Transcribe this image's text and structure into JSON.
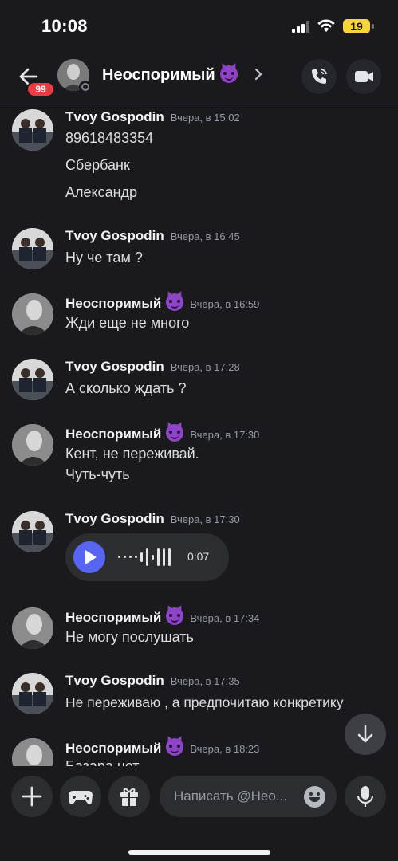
{
  "status_bar": {
    "time": "10:08",
    "battery": "19"
  },
  "header": {
    "unread_badge": "99",
    "contact_name": "Неоспоримый",
    "icons": [
      "back-arrow-icon",
      "chevron-right-icon",
      "phone-call-icon",
      "video-camera-icon"
    ]
  },
  "messages": [
    {
      "author": "Tvoy Gospodin",
      "time": "Вчера, в 15:02",
      "lines": [
        "89618483354",
        "Сбербанк",
        "Александр"
      ]
    },
    {
      "author": "Tvoy Gospodin",
      "time": "Вчера, в 16:45",
      "lines": [
        "Ну че там ?"
      ]
    },
    {
      "author": "Неоспоримый",
      "time": "Вчера, в 16:59",
      "lines": [
        "Жди еще не много"
      ]
    },
    {
      "author": "Tvoy Gospodin",
      "time": "Вчера, в 17:28",
      "lines": [
        "А сколько ждать ?"
      ]
    },
    {
      "author": "Неоспоримый",
      "time": "Вчера, в 17:30",
      "lines": [
        "Кент, не переживай.",
        "Чуть-чуть"
      ]
    },
    {
      "author": "Tvoy Gospodin",
      "time": "Вчера, в 17:30",
      "voice": {
        "duration": "0:07"
      }
    },
    {
      "author": "Неоспоримый",
      "time": "Вчера, в 17:34",
      "lines": [
        "Не могу послушать"
      ]
    },
    {
      "author": "Tvoy Gospodin",
      "time": "Вчера, в 17:35",
      "lines": [
        "Не переживаю , а предпочитаю конкретику"
      ]
    },
    {
      "author": "Неоспоримый",
      "time": "Вчера, в 18:23",
      "lines": [
        "Базара нет"
      ]
    }
  ],
  "composer": {
    "placeholder": "Написать @Нео...",
    "icons": [
      "plus-icon",
      "gamepad-icon",
      "gift-icon",
      "emoji-icon",
      "microphone-icon"
    ]
  },
  "colors": {
    "background": "#1a1a1e",
    "accent": "#5865f2",
    "badge": "#ef3a44",
    "devil_emoji": "#8e44c7"
  }
}
